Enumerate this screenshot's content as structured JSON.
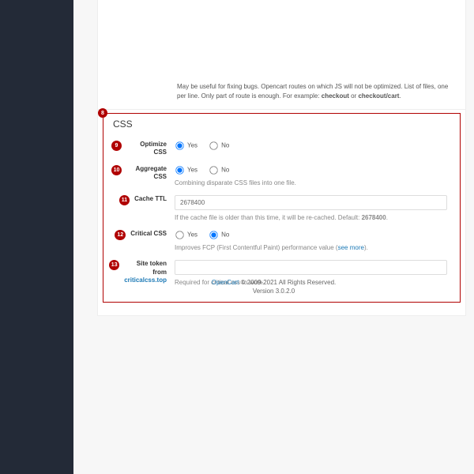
{
  "intro": {
    "text_prefix": "May be useful for fixing bugs. Opencart routes on which JS will not be optimized. List of files, one per line. Only part of route is enough. For example: ",
    "bold1": "checkout",
    "or": " or ",
    "bold2": "checkout/cart",
    "dot": "."
  },
  "section": {
    "badge": "8",
    "title": "CSS",
    "fields": {
      "optimize": {
        "badge": "9",
        "label": "Optimize CSS",
        "yes": "Yes",
        "no": "No"
      },
      "aggregate": {
        "badge": "10",
        "label": "Aggregate CSS",
        "yes": "Yes",
        "no": "No",
        "help": "Combining disparate CSS files into one file."
      },
      "cache": {
        "badge": "11",
        "label": "Cache TTL",
        "value": "2678400",
        "help_prefix": "If the cache file is older than this time, it will be re-cached. Default: ",
        "help_bold": "2678400",
        "help_dot": "."
      },
      "critical": {
        "badge": "12",
        "label": "Critical CSS",
        "yes": "Yes",
        "no": "No",
        "help_prefix": "Improves FCP (First Contentful Paint) performance value (",
        "help_link": "see more",
        "help_suffix": ")."
      },
      "token": {
        "badge": "13",
        "label_prefix": "Site token from ",
        "label_link": "criticalcss.top",
        "help": "Required for critical css to work."
      }
    }
  },
  "footer": {
    "link": "OpenCart",
    "copyright": " © 2009-2021 All Rights Reserved.",
    "version": "Version 3.0.2.0"
  }
}
